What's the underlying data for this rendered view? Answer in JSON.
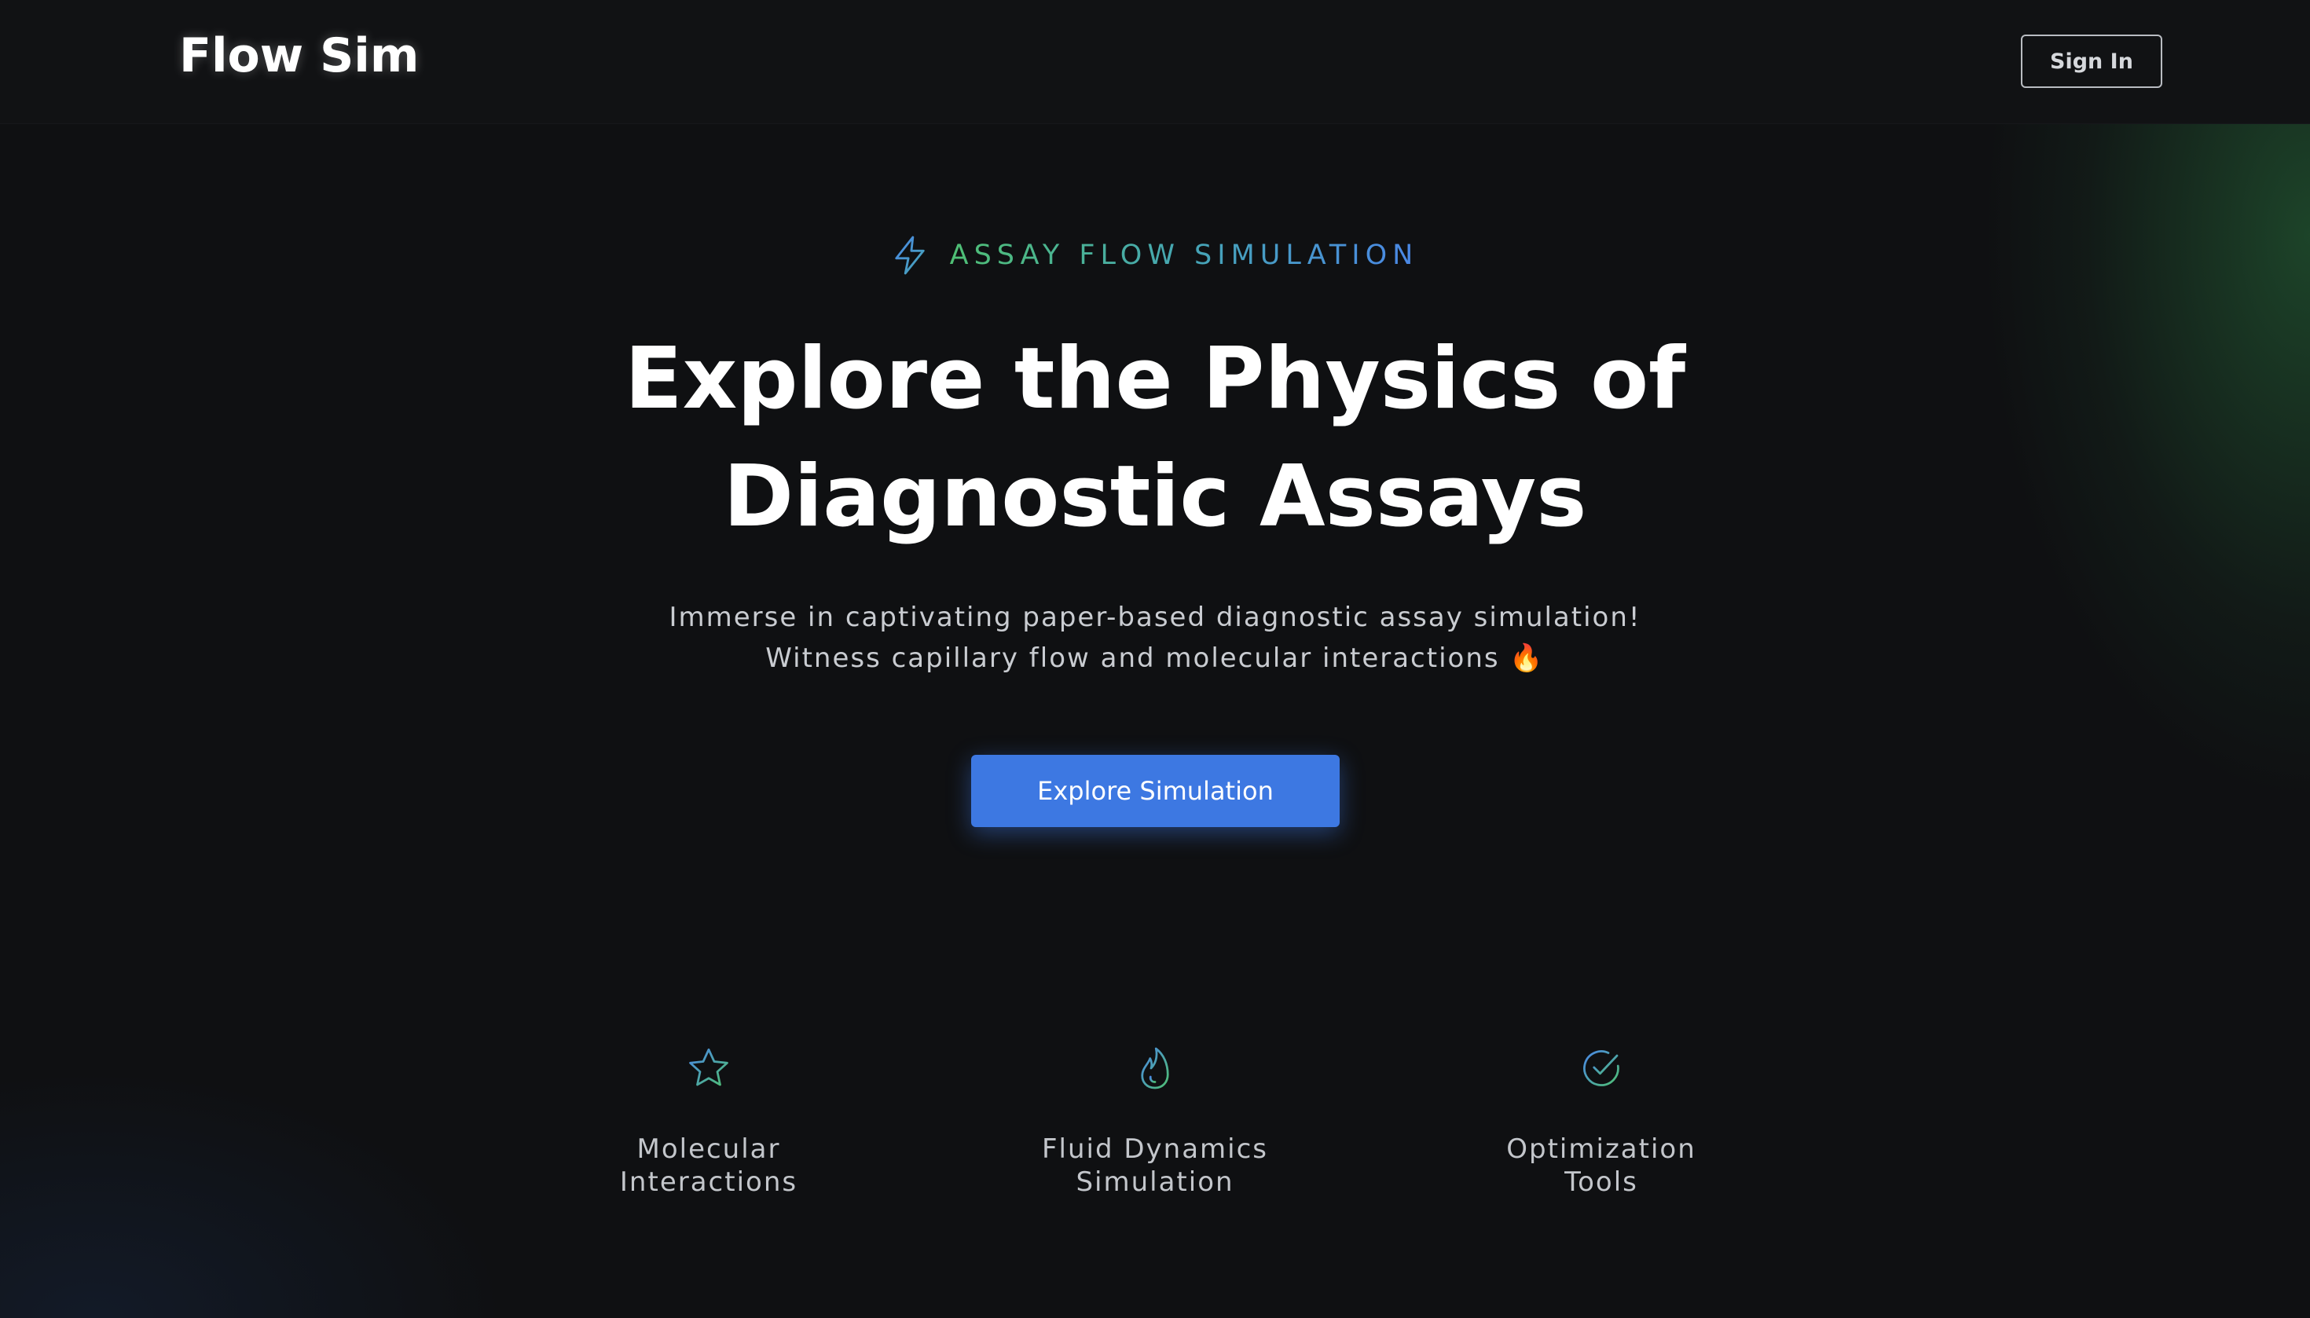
{
  "header": {
    "logo": "Flow Sim",
    "signin_label": "Sign In"
  },
  "hero": {
    "tagline": "ASSAY FLOW SIMULATION",
    "tagline_icon": "lightning-bolt",
    "title_line1": "Explore the Physics of",
    "title_line2": "Diagnostic Assays",
    "subtitle_line1": "Immerse in captivating paper-based diagnostic assay simulation!",
    "subtitle_line2": "Witness capillary flow and molecular interactions 🔥",
    "cta_label": "Explore Simulation"
  },
  "features": [
    {
      "icon": "star",
      "label_line1": "Molecular",
      "label_line2": "Interactions"
    },
    {
      "icon": "flame",
      "label_line1": "Fluid Dynamics",
      "label_line2": "Simulation"
    },
    {
      "icon": "check-circle",
      "label_line1": "Optimization",
      "label_line2": "Tools"
    }
  ],
  "colors": {
    "background": "#0f1012",
    "accent_blue": "#3d78e2",
    "accent_green": "#4fbf74",
    "text_muted": "#c9ccd1"
  }
}
